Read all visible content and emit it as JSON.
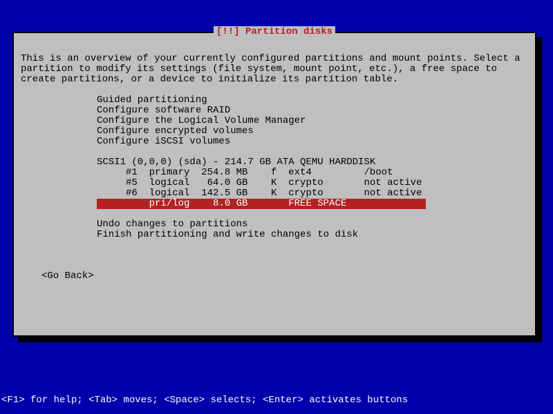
{
  "title": "[!!] Partition disks",
  "instructions": "This is an overview of your currently configured partitions and mount points. Select a partition to modify its settings (file system, mount point, etc.), a free space to create partitions, or a device to initialize its partition table.",
  "menu": {
    "guided": "Guided partitioning",
    "raid": "Configure software RAID",
    "lvm": "Configure the Logical Volume Manager",
    "encrypted": "Configure encrypted volumes",
    "iscsi": "Configure iSCSI volumes"
  },
  "disk": "SCSI1 (0,0,0) (sda) - 214.7 GB ATA QEMU HARDDISK",
  "partitions": {
    "p1": "     #1  primary  254.8 MB    f  ext4         /boot",
    "p5": "     #5  logical   64.0 GB    K  crypto       not active",
    "p6": "     #6  logical  142.5 GB    K  crypto       not active",
    "free": "         pri/log    8.0 GB       FREE SPACE"
  },
  "actions": {
    "undo": "Undo changes to partitions",
    "finish": "Finish partitioning and write changes to disk"
  },
  "goback": "<Go Back>",
  "help": "<F1> for help; <Tab> moves; <Space> selects; <Enter> activates buttons"
}
